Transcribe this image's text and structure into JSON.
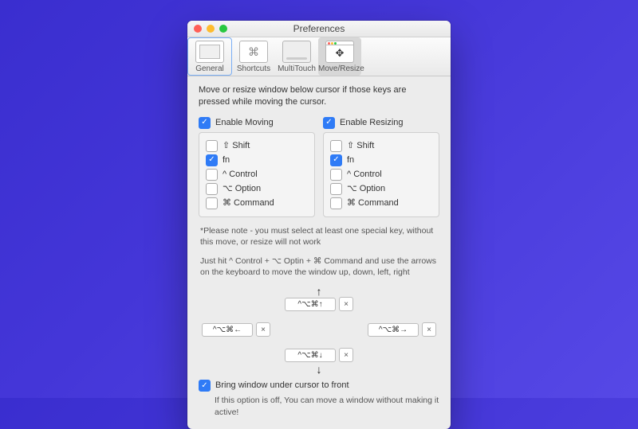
{
  "window": {
    "title": "Preferences"
  },
  "tabs": {
    "general": {
      "label": "General"
    },
    "shortcuts": {
      "label": "Shortcuts"
    },
    "multitouch": {
      "label": "MultiTouch"
    },
    "moveresize": {
      "label": "Move/Resize"
    }
  },
  "description": "Move or resize window below cursor if those keys are pressed while moving the cursor.",
  "moving": {
    "header": "Enable Moving"
  },
  "resizing": {
    "header": "Enable Resizing"
  },
  "keys": {
    "shift": "⇧ Shift",
    "fn": "fn",
    "control": "^ Control",
    "option": "⌥ Option",
    "command": "⌘ Command"
  },
  "checked": {
    "moving": {
      "header": true,
      "shift": false,
      "fn": true,
      "control": false,
      "option": false,
      "command": false
    },
    "resizing": {
      "header": true,
      "shift": false,
      "fn": true,
      "control": false,
      "option": false,
      "command": false
    }
  },
  "note1": "*Please note - you must select at least one special key, without this move, or resize will not work",
  "note2": "Just hit  ^ Control + ⌥ Optin + ⌘ Command and use the arrows on the keyboard to move the window up, down, left, right",
  "diagram": {
    "up": "^⌥⌘↑",
    "down": "^⌥⌘↓",
    "left": "^⌥⌘←",
    "right": "^⌥⌘→",
    "close": "×"
  },
  "footer": {
    "bring": "Bring window under cursor to front",
    "bring_checked": true,
    "bring_sub": "If this option is off, You can move a window without making it active!"
  }
}
